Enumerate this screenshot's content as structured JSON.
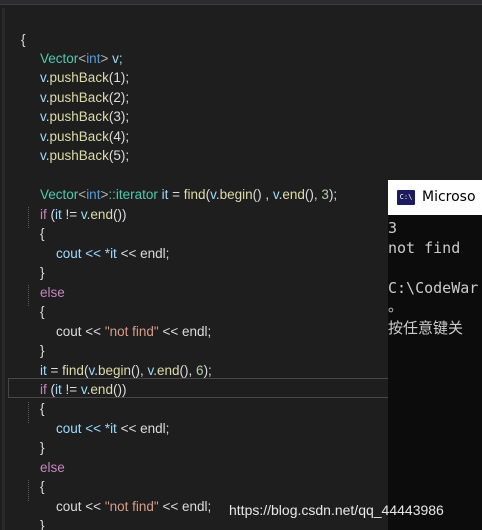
{
  "code": {
    "open_brace": "{",
    "vector_type": "Vector",
    "int_kw": "int",
    "lt": "<",
    "gt": ">",
    "decl_var": " v;",
    "var_v": "v",
    "push_back": "pushBack",
    "push_args": [
      "(1);",
      "(2);",
      "(3);",
      "(4);",
      "(5);"
    ],
    "dot": ".",
    "iterator_kw": "::iterator",
    "it": "it",
    "find_fn": "find",
    "begin_fn": "begin",
    "end_fn": "end",
    "find1_mid": " = ",
    "find1_args_a": "(",
    "find1_args_b": "() , ",
    "find1_args_c": "(), ",
    "num3": "3",
    "close_paren_semi": ");",
    "if_kw": "if",
    "if_cond_a": " (",
    "if_cond_b": " != ",
    "if_cond_c": "())",
    "brace_open": "{",
    "brace_close": "}",
    "cout_a": "cout << *",
    "cout_b": " << endl;",
    "cout_nf_a": "cout << ",
    "not_find_str": "\"not find\"",
    "cout_nf_b": " << endl;",
    "else_kw": "else",
    "find2_b": "(), ",
    "num6": "6"
  },
  "console": {
    "title": "Microso",
    "icon_text": "C:\\",
    "lines": [
      "3",
      "not find",
      "",
      "C:\\CodeWar",
      "。",
      "按任意键关"
    ]
  },
  "watermark": "https://blog.csdn.net/qq_44443986"
}
